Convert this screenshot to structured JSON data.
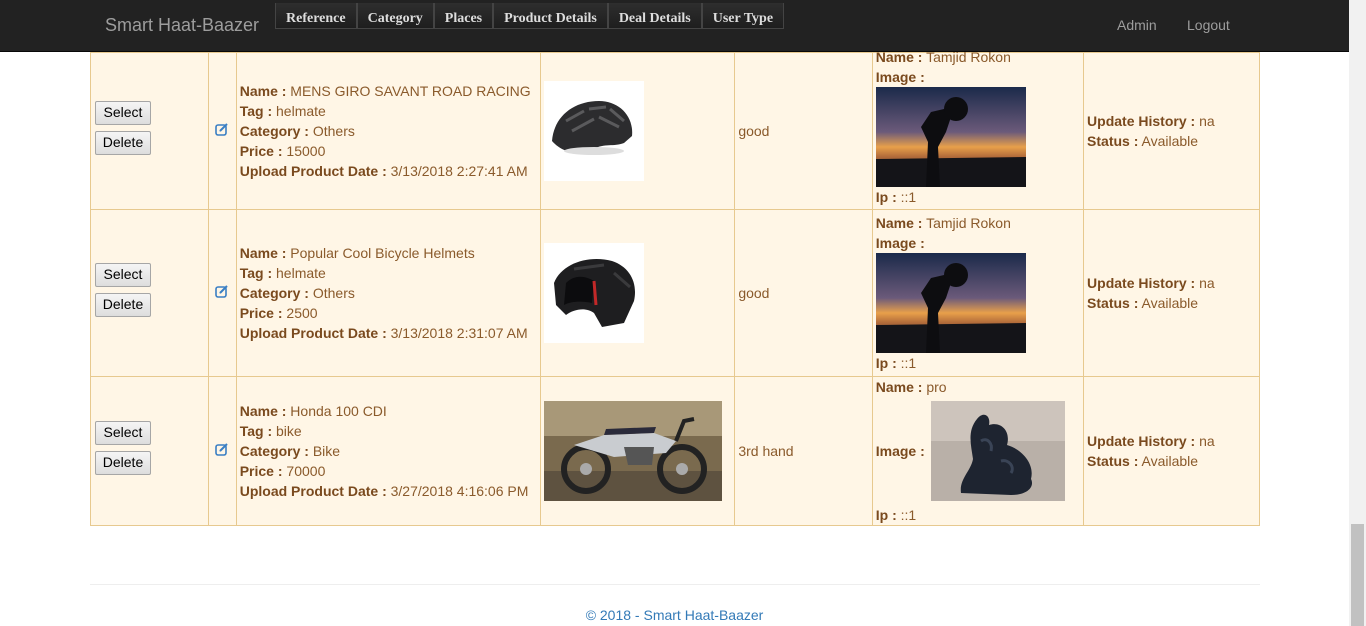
{
  "nav": {
    "brand": "Smart Haat-Baazer",
    "menu": [
      "Reference",
      "Category",
      "Places",
      "Product Details",
      "Deal Details",
      "User Type"
    ],
    "admin": "Admin",
    "logout": "Logout"
  },
  "labels": {
    "select": "Select",
    "delete": "Delete",
    "name": "Name :",
    "tag": "Tag :",
    "category": "Category :",
    "price": "Price :",
    "upload_date": "Upload Product Date :",
    "image": "Image :",
    "ip": "Ip :",
    "update_history": "Update History :",
    "status": "Status :"
  },
  "rows": [
    {
      "name": "MENS GIRO SAVANT ROAD RACING",
      "tag": "helmate",
      "category": "Others",
      "price": "15000",
      "upload_date": "3/13/2018 2:27:41 AM",
      "condition": "good",
      "user_name": "Tamjid Rokon",
      "ip": "::1",
      "update_history": "na",
      "status": "Available"
    },
    {
      "name": "Popular Cool Bicycle Helmets",
      "tag": "helmate",
      "category": "Others",
      "price": "2500",
      "upload_date": "3/13/2018 2:31:07 AM",
      "condition": "good",
      "user_name": "Tamjid Rokon",
      "ip": "::1",
      "update_history": "na",
      "status": "Available"
    },
    {
      "name": "Honda 100 CDI",
      "tag": "bike",
      "category": "Bike",
      "price": "70000",
      "upload_date": "3/27/2018 4:16:06 PM",
      "condition": "3rd hand",
      "user_name": "pro",
      "ip": "::1",
      "update_history": "na",
      "status": "Available"
    }
  ],
  "footer": {
    "text": "© 2018 - Smart Haat-Baazer"
  },
  "colors": {
    "navbar": "#222222",
    "row_bg": "#fff6e6",
    "border": "#e7c98f",
    "text": "#8a5a2b",
    "link": "#337ab7"
  }
}
